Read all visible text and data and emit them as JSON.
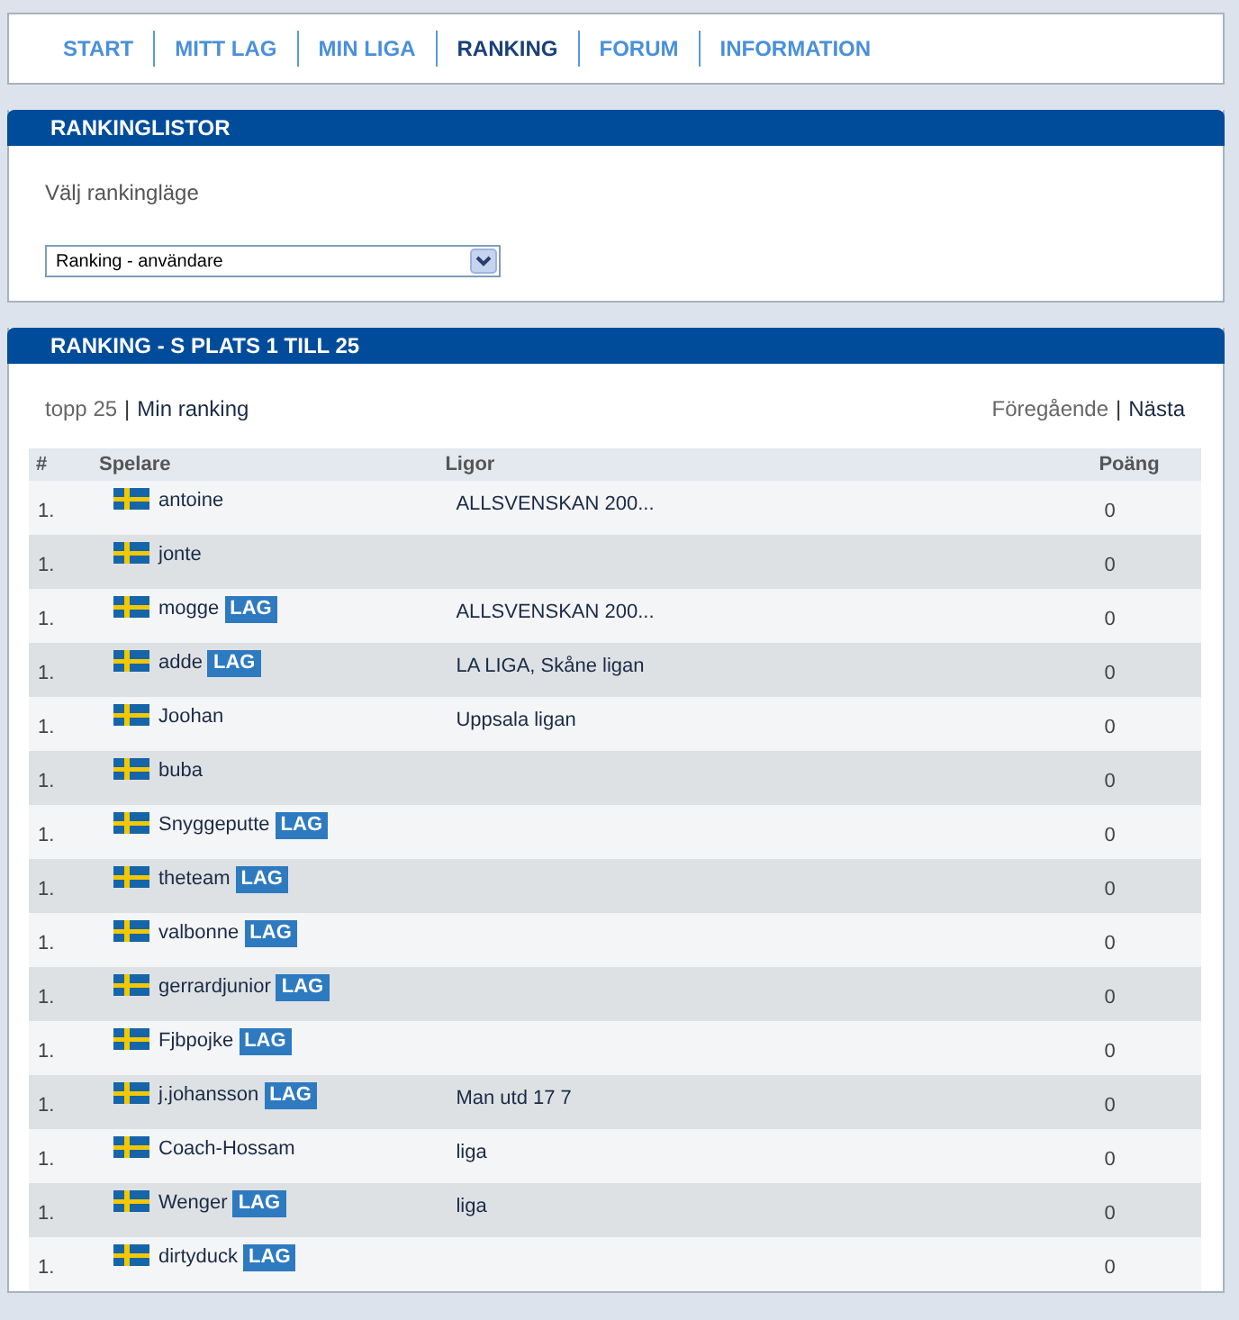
{
  "nav": [
    {
      "label": "START",
      "selected": false
    },
    {
      "label": "MITT LAG",
      "selected": false
    },
    {
      "label": "MIN LIGA",
      "selected": false
    },
    {
      "label": "RANKING",
      "selected": true
    },
    {
      "label": "FORUM",
      "selected": false
    },
    {
      "label": "INFORMATION",
      "selected": false
    }
  ],
  "mode_panel": {
    "title": "RANKINGLISTOR",
    "label": "Välj rankingläge",
    "select": {
      "value": "Ranking - användare"
    }
  },
  "ranking_panel": {
    "title": "RANKING - S PLATS 1 TILL 25",
    "separator": "|",
    "filter_links": [
      {
        "label": "topp 25",
        "selected": true
      },
      {
        "label": "Min ranking",
        "selected": false
      }
    ],
    "pager_links": [
      {
        "label": "Föregående",
        "disabled": true
      },
      {
        "label": "Nästa",
        "disabled": false
      }
    ],
    "table": {
      "columns": [
        "#",
        "Spelare",
        "Ligor",
        "Poäng"
      ],
      "rows": [
        {
          "rank": "1.",
          "player": "antoine",
          "leagues": "ALLSVENSKAN 200...",
          "points": "0"
        },
        {
          "rank": "1.",
          "player": "jonte",
          "points": "0"
        },
        {
          "rank": "1.",
          "player": "mogge",
          "badge": "LAG",
          "leagues": "ALLSVENSKAN 200...",
          "points": "0"
        },
        {
          "rank": "1.",
          "player": "adde",
          "badge": "LAG",
          "leagues": "LA LIGA, Skåne ligan",
          "points": "0"
        },
        {
          "rank": "1.",
          "player": "Joohan",
          "leagues": "Uppsala ligan",
          "points": "0"
        },
        {
          "rank": "1.",
          "player": "buba",
          "points": "0"
        },
        {
          "rank": "1.",
          "player": "Snyggeputte",
          "badge": "LAG",
          "points": "0"
        },
        {
          "rank": "1.",
          "player": "theteam",
          "badge": "LAG",
          "points": "0"
        },
        {
          "rank": "1.",
          "player": "valbonne",
          "badge": "LAG",
          "points": "0"
        },
        {
          "rank": "1.",
          "player": "gerrardjunior",
          "badge": "LAG",
          "points": "0"
        },
        {
          "rank": "1.",
          "player": "Fjbpojke",
          "badge": "LAG",
          "points": "0"
        },
        {
          "rank": "1.",
          "player": "j.johansson",
          "badge": "LAG",
          "leagues": "Man utd 17 7",
          "points": "0"
        },
        {
          "rank": "1.",
          "player": "Coach-Hossam",
          "leagues": "liga",
          "points": "0"
        },
        {
          "rank": "1.",
          "player": "Wenger",
          "badge": "LAG",
          "leagues": "liga",
          "points": "0"
        },
        {
          "rank": "1.",
          "player": "dirtyduck",
          "badge": "LAG",
          "points": "0"
        }
      ]
    }
  }
}
